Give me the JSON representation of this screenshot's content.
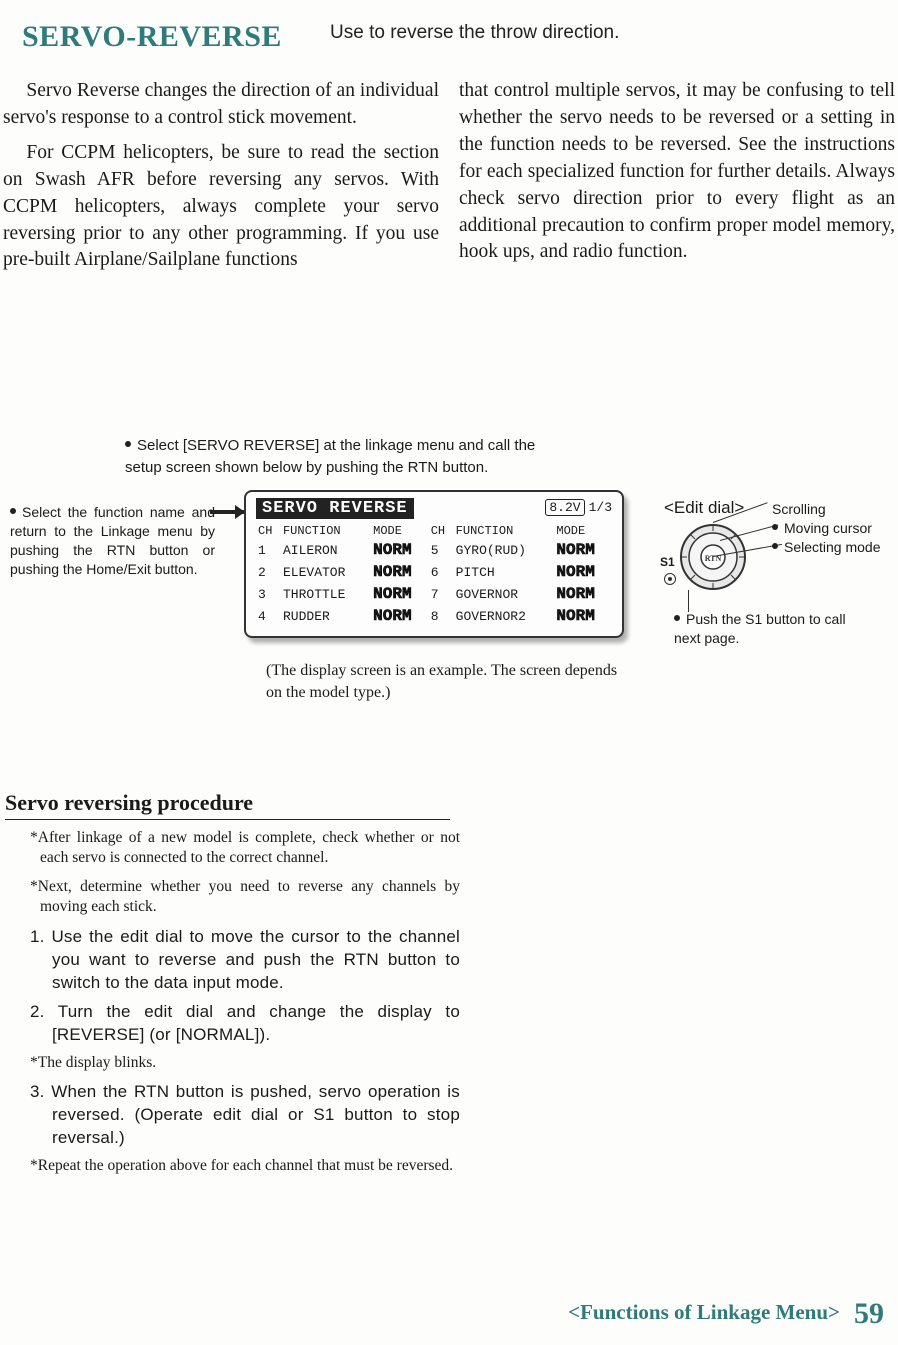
{
  "header": {
    "title": "SERVO-REVERSE",
    "subtitle": "Use to reverse the throw direction."
  },
  "body": {
    "p1": "Servo Reverse changes the direction of an individual servo's response to a control stick movement.",
    "p2": "For CCPM helicopters, be sure to read the section on Swash AFR  before reversing any servos. With CCPM helicopters, always complete your servo reversing prior to any other programming. If you use pre-built Airplane/Sailplane functions",
    "p3": "that control multiple servos, it may be confusing to tell whether the servo needs to be reversed or a setting in the function needs to be reversed. See the instructions for each specialized function for further details. Always check servo direction prior to every flight as an additional precaution to confirm proper model memory, hook ups, and radio function."
  },
  "instructions": {
    "select_above": "Select [SERVO REVERSE] at the linkage menu and call the setup screen shown below by pushing the RTN button.",
    "select_left": "Select the function name and return to the Linkage menu by pushing the RTN button or pushing the Home/Exit button.",
    "caption": "(The display screen is an example. The screen depends on the model type.)"
  },
  "lcd": {
    "title": "SERVO REVERSE",
    "voltage": "8.2V",
    "page": "1/3",
    "headers": {
      "ch": "CH",
      "func": "FUNCTION",
      "mode": "MODE"
    },
    "rows_left": [
      {
        "ch": "1",
        "func": "AILERON",
        "mode": "NORM"
      },
      {
        "ch": "2",
        "func": "ELEVATOR",
        "mode": "NORM"
      },
      {
        "ch": "3",
        "func": "THROTTLE",
        "mode": "NORM"
      },
      {
        "ch": "4",
        "func": "RUDDER",
        "mode": "NORM"
      }
    ],
    "rows_right": [
      {
        "ch": "5",
        "func": "GYRO(RUD)",
        "mode": "NORM"
      },
      {
        "ch": "6",
        "func": "PITCH",
        "mode": "NORM"
      },
      {
        "ch": "7",
        "func": "GOVERNOR",
        "mode": "NORM"
      },
      {
        "ch": "8",
        "func": "GOVERNOR2",
        "mode": "NORM"
      }
    ]
  },
  "dial": {
    "label": "<Edit dial>",
    "s1": "S1",
    "note_scroll": "Scrolling",
    "note_move": "Moving cursor",
    "note_select": "Selecting mode",
    "push": "Push the S1 button to call next page."
  },
  "procedure": {
    "title": "Servo reversing procedure",
    "note1": "*After linkage of a new model is complete, check whether or not each servo is connected to the correct channel.",
    "note2": "*Next, determine whether you need to reverse any channels by moving each stick.",
    "step1": "1. Use the edit dial to move the cursor to the channel you want to reverse and push the RTN button to switch to the data input mode.",
    "step2": "2. Turn the edit dial and change the display to [REVERSE] (or [NORMAL]).",
    "blinks": "*The display blinks.",
    "step3": "3. When the RTN button is pushed, servo operation is reversed. (Operate edit dial or S1 button to stop reversal.)",
    "note3": "*Repeat the operation above for each channel that must be reversed."
  },
  "footer": {
    "section": "<Functions of Linkage Menu>",
    "page": "59"
  }
}
